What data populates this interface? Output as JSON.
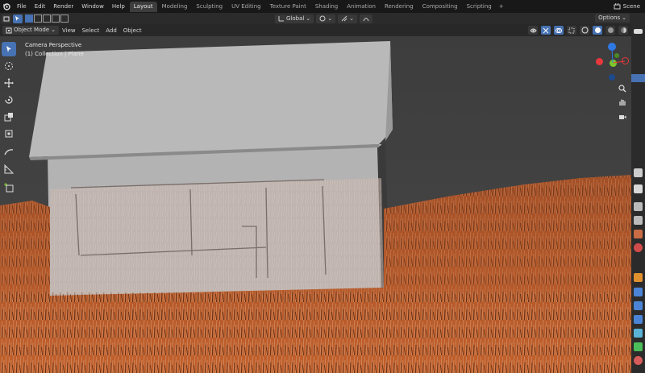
{
  "topbar": {
    "menus": [
      "File",
      "Edit",
      "Render",
      "Window",
      "Help"
    ],
    "workspaces": [
      "Layout",
      "Modeling",
      "Sculpting",
      "UV Editing",
      "Texture Paint",
      "Shading",
      "Animation",
      "Rendering",
      "Compositing",
      "Scripting"
    ],
    "active_workspace": "Layout",
    "add_tab": "+",
    "scene": "Scene"
  },
  "header": {
    "transform_orientation": "Global",
    "options": "Options"
  },
  "viewport_header": {
    "mode": "Object Mode",
    "menus": [
      "View",
      "Select",
      "Add",
      "Object"
    ]
  },
  "viewport": {
    "camera_label": "Camera Perspective",
    "collection_label": "(1) Collection | Plane"
  },
  "gizmo": {
    "axes": [
      "X",
      "Y",
      "Z"
    ],
    "colors": {
      "x": "#e8383d",
      "y": "#7dc72c",
      "z": "#2f79e3"
    }
  },
  "toolbar_icons": [
    "select-box-icon",
    "cursor-icon",
    "move-icon",
    "rotate-icon",
    "scale-icon",
    "transform-icon",
    "annotate-icon",
    "measure-icon",
    "add-cube-icon"
  ],
  "colors": {
    "accent": "#4772b3",
    "grass": "#b4572a",
    "house": "#b5b5b5",
    "sky": "#3f3f3f"
  }
}
